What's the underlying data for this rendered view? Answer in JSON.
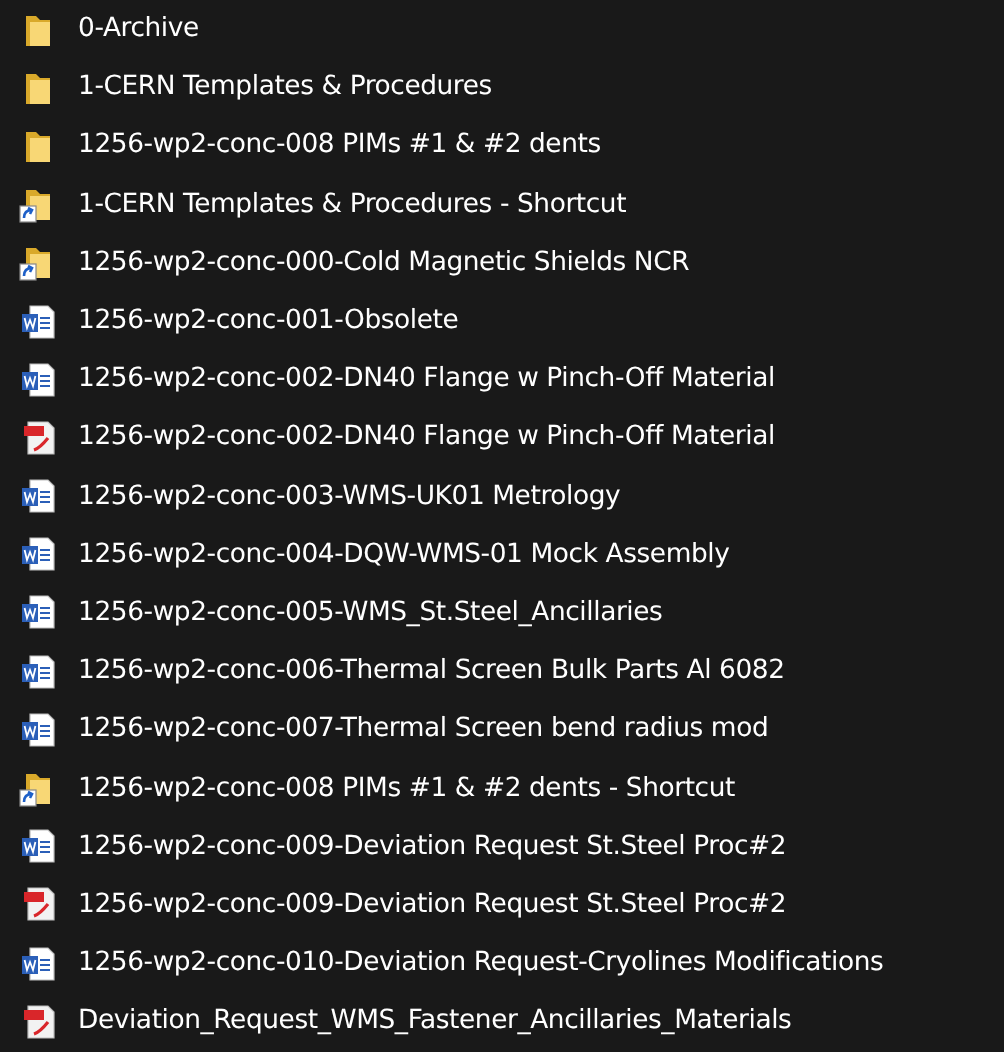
{
  "files": [
    {
      "name": "0-Archive",
      "kind": "folder"
    },
    {
      "name": "1-CERN Templates & Procedures",
      "kind": "folder"
    },
    {
      "name": "1256-wp2-conc-008 PIMs #1 & #2 dents",
      "kind": "folder"
    },
    {
      "name": "1-CERN Templates & Procedures - Shortcut",
      "kind": "folder-shortcut"
    },
    {
      "name": "1256-wp2-conc-000-Cold Magnetic Shields NCR",
      "kind": "folder-shortcut"
    },
    {
      "name": "1256-wp2-conc-001-Obsolete",
      "kind": "word"
    },
    {
      "name": "1256-wp2-conc-002-DN40 Flange w Pinch-Off Material",
      "kind": "word"
    },
    {
      "name": "1256-wp2-conc-002-DN40 Flange w Pinch-Off Material",
      "kind": "pdf"
    },
    {
      "name": "1256-wp2-conc-003-WMS-UK01 Metrology",
      "kind": "word"
    },
    {
      "name": "1256-wp2-conc-004-DQW-WMS-01 Mock Assembly",
      "kind": "word"
    },
    {
      "name": "1256-wp2-conc-005-WMS_St.Steel_Ancillaries",
      "kind": "word"
    },
    {
      "name": "1256-wp2-conc-006-Thermal Screen Bulk Parts Al 6082",
      "kind": "word"
    },
    {
      "name": "1256-wp2-conc-007-Thermal Screen bend radius mod",
      "kind": "word"
    },
    {
      "name": "1256-wp2-conc-008 PIMs #1 & #2 dents - Shortcut",
      "kind": "folder-shortcut"
    },
    {
      "name": "1256-wp2-conc-009-Deviation Request St.Steel Proc#2",
      "kind": "word"
    },
    {
      "name": "1256-wp2-conc-009-Deviation Request St.Steel Proc#2",
      "kind": "pdf"
    },
    {
      "name": "1256-wp2-conc-010-Deviation Request-Cryolines Modifications",
      "kind": "word"
    },
    {
      "name": "Deviation_Request_WMS_Fastener_Ancillaries_Materials",
      "kind": "pdf"
    }
  ]
}
